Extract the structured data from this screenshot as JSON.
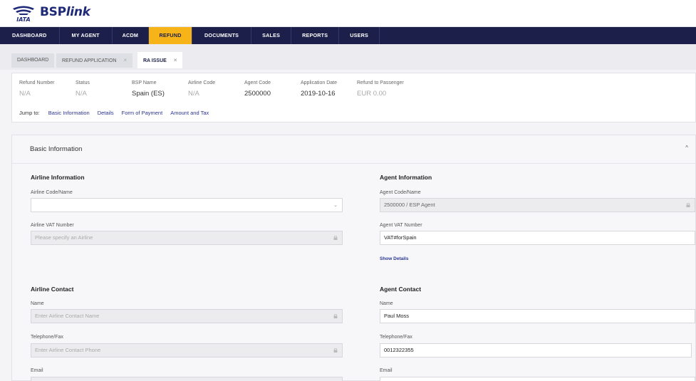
{
  "brand": {
    "mark": "IATA",
    "name_bsp": "BSP",
    "name_link": "link"
  },
  "nav": [
    {
      "label": "DASHBOARD",
      "active": false
    },
    {
      "label": "MY AGENT",
      "active": false
    },
    {
      "label": "ACDM",
      "active": false
    },
    {
      "label": "REFUND",
      "active": true
    },
    {
      "label": "DOCUMENTS",
      "active": false
    },
    {
      "label": "SALES",
      "active": false
    },
    {
      "label": "REPORTS",
      "active": false
    },
    {
      "label": "USERS",
      "active": false
    }
  ],
  "tabs": {
    "dashboard": "DASHBOARD",
    "refund_application": "REFUND APPLICATION",
    "ra_issue": "RA ISSUE",
    "close": "×"
  },
  "summary": {
    "refund_number": {
      "label": "Refund Number",
      "value": "N/A"
    },
    "status": {
      "label": "Status",
      "value": "N/A"
    },
    "bsp_name": {
      "label": "BSP Name",
      "value": "Spain (ES)"
    },
    "airline_code": {
      "label": "Airline Code",
      "value": "N/A"
    },
    "agent_code": {
      "label": "Agent Code",
      "value": "2500000"
    },
    "application_date": {
      "label": "Application Date",
      "value": "2019-10-16"
    },
    "refund_to_passenger": {
      "label": "Refund to Passenger",
      "value": "EUR 0.00"
    }
  },
  "jump": {
    "label": "Jump to:",
    "links": [
      "Basic Information",
      "Details",
      "Form of Payment",
      "Amount and Tax"
    ]
  },
  "basic": {
    "title": "Basic Information",
    "caret": "^",
    "airline_info": {
      "title": "Airline Information",
      "code_label": "Airline Code/Name",
      "code_value": "",
      "vat_label": "Airline VAT Number",
      "vat_placeholder": "Please specify an Airline"
    },
    "agent_info": {
      "title": "Agent Information",
      "code_label": "Agent Code/Name",
      "code_value": "2500000 / ESP Agent",
      "vat_label": "Agent VAT Number",
      "vat_value": "VAT#forSpain",
      "show_details": "Show Details"
    },
    "airline_contact": {
      "title": "Airline Contact",
      "name_label": "Name",
      "name_placeholder": "Enter Airline Contact Name",
      "phone_label": "Telephone/Fax",
      "phone_placeholder": "Enter Airline Contact Phone",
      "email_label": "Email"
    },
    "agent_contact": {
      "title": "Agent Contact",
      "name_label": "Name",
      "name_value": "Paul Moss",
      "phone_label": "Telephone/Fax",
      "phone_value": "0012322355",
      "email_label": "Email"
    }
  },
  "colors": {
    "nav_bg": "#1c1f4a",
    "nav_active": "#f6b419",
    "link": "#2a3592"
  },
  "icons": [
    "iata-logo-icon",
    "close-icon",
    "lock-icon",
    "chevron-down-icon",
    "chevron-up-icon"
  ]
}
